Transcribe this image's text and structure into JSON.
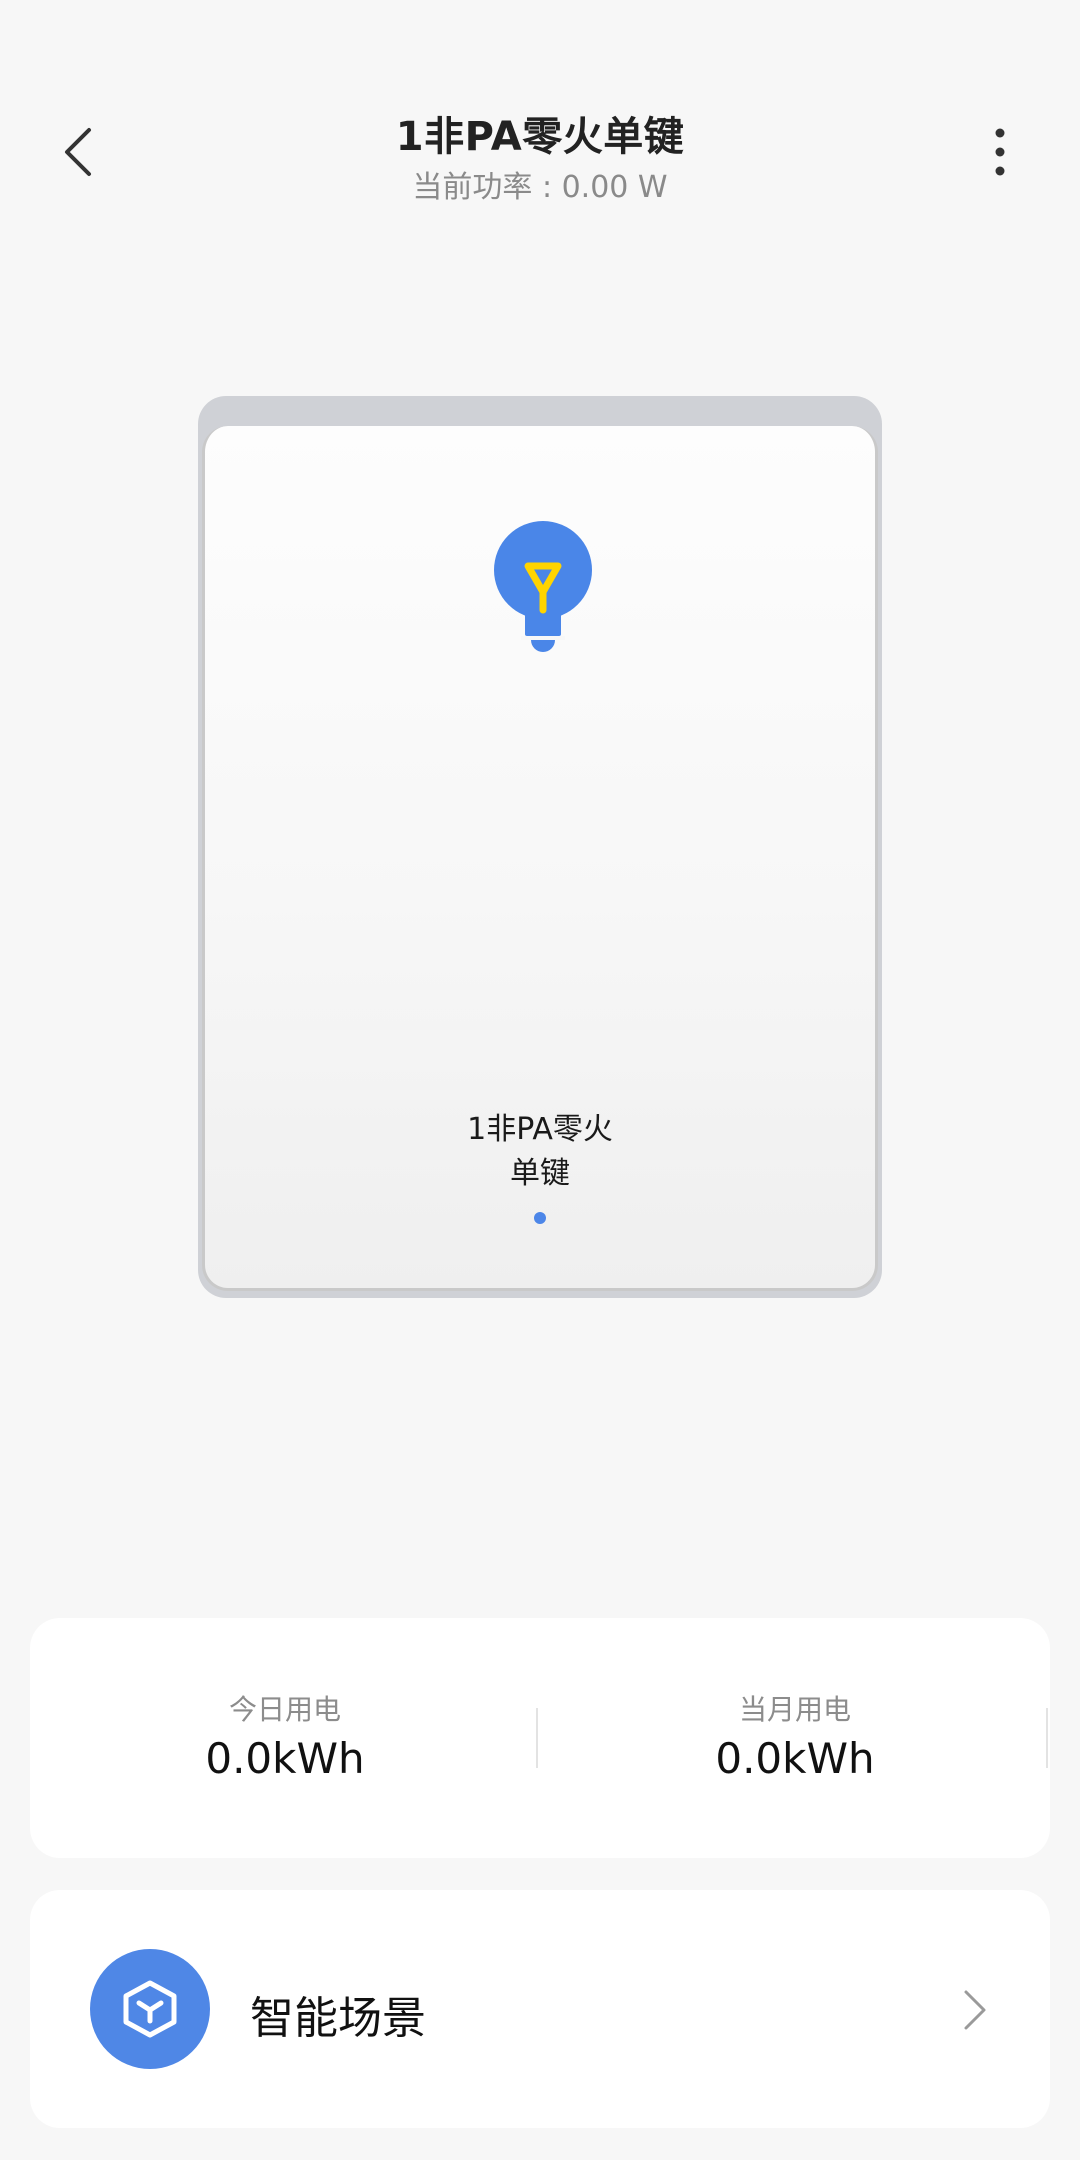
{
  "header": {
    "title": "1非PA零火单键",
    "subtitle": "当前功率 : 0.00 W",
    "back_icon": "chevron-left-icon",
    "more_icon": "more-vertical-icon"
  },
  "device": {
    "switch_label_line1": "1非PA零火",
    "switch_label_line2": "单键",
    "bulb_icon": "lightbulb-icon",
    "accent_color": "#4a86e8",
    "filament_color": "#ffd400"
  },
  "energy": {
    "today_label": "今日用电",
    "today_value": "0.0kWh",
    "month_label": "当月用电",
    "month_value": "0.0kWh"
  },
  "scene": {
    "label": "智能场景",
    "icon": "cube-icon",
    "chevron_icon": "chevron-right-icon"
  }
}
